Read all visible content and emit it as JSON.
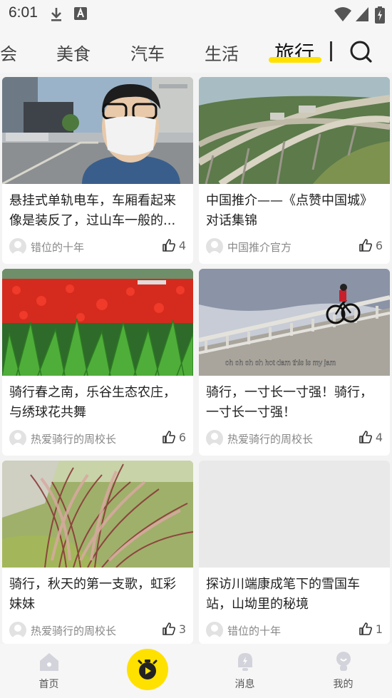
{
  "status_bar": {
    "time": "6:01"
  },
  "tabs": [
    {
      "label": "会"
    },
    {
      "label": "美食"
    },
    {
      "label": "汽车"
    },
    {
      "label": "生活"
    },
    {
      "label": "旅行",
      "active": true
    }
  ],
  "colors": {
    "accent": "#ffe100",
    "text": "#222222",
    "muted": "#888888"
  },
  "cards": [
    {
      "title": "悬挂式单轨电车，车厢看起来像是装反了，过山车一般的...",
      "author": "错位的十年",
      "likes": "4"
    },
    {
      "title": "中国推介——《点赞中国城》对话集锦",
      "author": "中国推介官方",
      "likes": "6"
    },
    {
      "title": "骑行春之南，乐谷生态农庄，与绣球花共舞",
      "author": "热爱骑行的周校长",
      "likes": "6"
    },
    {
      "title": "骑行，一寸长一寸强！骑行，一寸长一寸强！",
      "author": "热爱骑行的周校长",
      "likes": "4",
      "caption": "oh oh oh oh hot dam this is my jam"
    },
    {
      "title": "骑行，秋天的第一支歌，虹彩妹妹",
      "author": "热爱骑行的周校长",
      "likes": "3"
    },
    {
      "title": "探访川端康成笔下的雪国车站，山坳里的秘境",
      "author": "错位的十年",
      "likes": "1"
    }
  ],
  "bottom_nav": {
    "home": "首页",
    "messages": "消息",
    "mine": "我的"
  },
  "icons": [
    "download-icon",
    "font-icon",
    "wifi-icon",
    "signal-icon",
    "battery-icon",
    "search-icon",
    "thumbs-up-icon",
    "home-icon",
    "bell-icon",
    "user-icon",
    "camera-icon"
  ]
}
